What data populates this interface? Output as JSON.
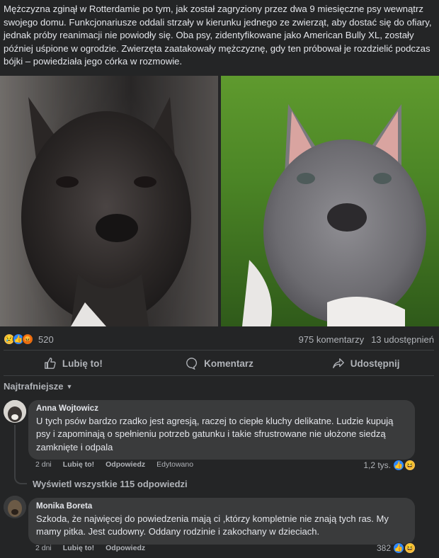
{
  "post": {
    "text": "Mężczyzna zginął w Rotterdamie po tym, jak został zagryziony przez dwa 9 miesięczne psy wewnątrz swojego domu. Funkcjonariusze oddali strzały w kierunku jednego ze zwierząt, aby dostać się do ofiary, jednak próby reanimacji nie powiodły się. Oba psy, zidentyfikowane jako American Bully XL, zostały później uśpione w ogrodzie. Zwierzęta zaatakowały mężczyznę, gdy ten próbował je rozdzielić podczas bójki – powiedziała jego córka w rozmowie."
  },
  "stats": {
    "reaction_count": "520",
    "comments": "975 komentarzy",
    "shares": "13 udostępnień"
  },
  "actions": {
    "like": "Lubię to!",
    "comment": "Komentarz",
    "share": "Udostępnij"
  },
  "sort": {
    "label": "Najtrafniejsze"
  },
  "comments": [
    {
      "author": "Anna Wojtowicz",
      "text": "U tych psów bardzo rzadko jest agresją, raczej to ciepłe kluchy delikatne. Ludzie kupują psy i zapominają o spełnieniu potrzeb gatunku i takie sfrustrowane nie ułożone siedzą zamknięte i odpala",
      "time": "2 dni",
      "like": "Lubię to!",
      "reply": "Odpowiedz",
      "edited": "Edytowano",
      "reactions": "1,2 tys."
    },
    {
      "author": "Monika Boreta",
      "text": "Szkoda, że najwięcej do powiedzenia mają ci ,którzy kompletnie nie znają tych ras. My mamy pitka. Jest cudowny. Oddany rodzinie i zakochany w dzieciach.",
      "time": "2 dni",
      "like": "Lubię to!",
      "reply": "Odpowiedz",
      "reactions": "382"
    }
  ],
  "replies_link": "Wyświetl wszystkie 115 odpowiedzi",
  "colors": {
    "background": "#242526",
    "bubble": "#3a3b3c",
    "text": "#e4e6eb",
    "muted": "#b0b3b8",
    "like_blue": "#2d88ff"
  }
}
